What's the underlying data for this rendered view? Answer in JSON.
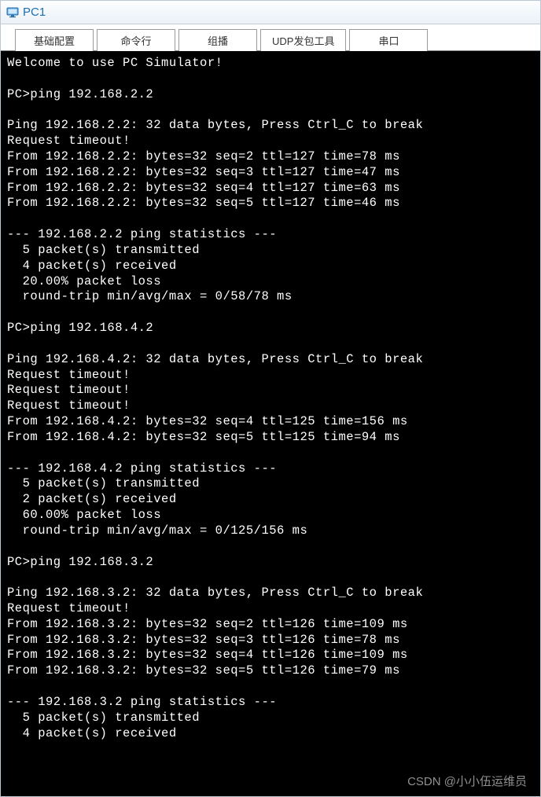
{
  "window": {
    "title": "PC1"
  },
  "tabs": [
    {
      "label": "基础配置",
      "active": false
    },
    {
      "label": "命令行",
      "active": true
    },
    {
      "label": "组播",
      "active": false
    },
    {
      "label": "UDP发包工具",
      "active": false
    },
    {
      "label": "串口",
      "active": false
    }
  ],
  "terminal": {
    "lines": [
      "Welcome to use PC Simulator!",
      "",
      "PC>ping 192.168.2.2",
      "",
      "Ping 192.168.2.2: 32 data bytes, Press Ctrl_C to break",
      "Request timeout!",
      "From 192.168.2.2: bytes=32 seq=2 ttl=127 time=78 ms",
      "From 192.168.2.2: bytes=32 seq=3 ttl=127 time=47 ms",
      "From 192.168.2.2: bytes=32 seq=4 ttl=127 time=63 ms",
      "From 192.168.2.2: bytes=32 seq=5 ttl=127 time=46 ms",
      "",
      "--- 192.168.2.2 ping statistics ---",
      "  5 packet(s) transmitted",
      "  4 packet(s) received",
      "  20.00% packet loss",
      "  round-trip min/avg/max = 0/58/78 ms",
      "",
      "PC>ping 192.168.4.2",
      "",
      "Ping 192.168.4.2: 32 data bytes, Press Ctrl_C to break",
      "Request timeout!",
      "Request timeout!",
      "Request timeout!",
      "From 192.168.4.2: bytes=32 seq=4 ttl=125 time=156 ms",
      "From 192.168.4.2: bytes=32 seq=5 ttl=125 time=94 ms",
      "",
      "--- 192.168.4.2 ping statistics ---",
      "  5 packet(s) transmitted",
      "  2 packet(s) received",
      "  60.00% packet loss",
      "  round-trip min/avg/max = 0/125/156 ms",
      "",
      "PC>ping 192.168.3.2",
      "",
      "Ping 192.168.3.2: 32 data bytes, Press Ctrl_C to break",
      "Request timeout!",
      "From 192.168.3.2: bytes=32 seq=2 ttl=126 time=109 ms",
      "From 192.168.3.2: bytes=32 seq=3 ttl=126 time=78 ms",
      "From 192.168.3.2: bytes=32 seq=4 ttl=126 time=109 ms",
      "From 192.168.3.2: bytes=32 seq=5 ttl=126 time=79 ms",
      "",
      "--- 192.168.3.2 ping statistics ---",
      "  5 packet(s) transmitted",
      "  4 packet(s) received"
    ]
  },
  "watermark": "CSDN @小小伍运维员"
}
